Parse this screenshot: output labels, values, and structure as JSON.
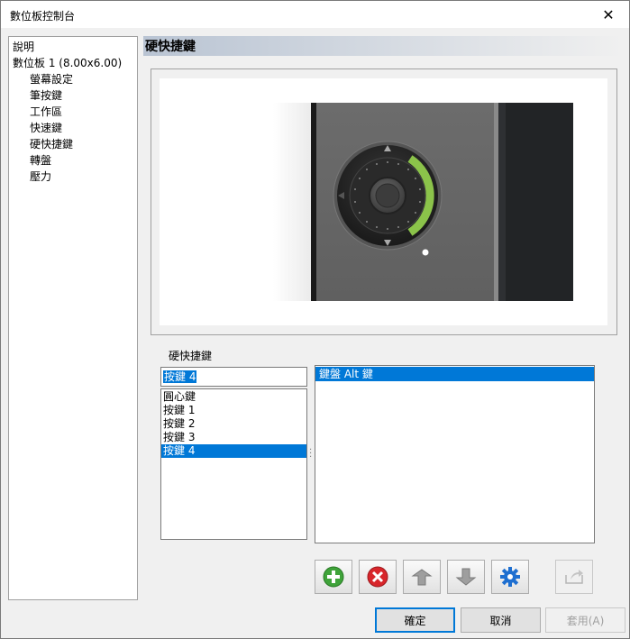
{
  "window": {
    "title": "數位板控制台",
    "close_glyph": "✕"
  },
  "tree": {
    "items": [
      {
        "label": "說明",
        "level": 0
      },
      {
        "label": "數位板 1 (8.00x6.00)",
        "level": 0
      },
      {
        "label": "螢幕設定",
        "level": 1
      },
      {
        "label": "筆按鍵",
        "level": 1
      },
      {
        "label": "工作區",
        "level": 1
      },
      {
        "label": "快速鍵",
        "level": 1
      },
      {
        "label": "硬快捷鍵",
        "level": 1
      },
      {
        "label": "轉盤",
        "level": 1
      },
      {
        "label": "壓力",
        "level": 1
      }
    ]
  },
  "section": {
    "title": "硬快捷鍵"
  },
  "hotkeys": {
    "label": "硬快捷鍵",
    "current_key": "按鍵 4",
    "keys": [
      "圓心鍵",
      "按鍵 1",
      "按鍵 2",
      "按鍵 3",
      "按鍵 4"
    ],
    "selected_key_index": 4,
    "actions": [
      "鍵盤 Alt 鍵"
    ],
    "selected_action_index": 0
  },
  "toolbar": {
    "add_icon": "plus-circle-green",
    "delete_icon": "x-circle-red",
    "move_up_icon": "arrow-up-gray",
    "move_down_icon": "arrow-down-gray",
    "settings_icon": "gear-blue",
    "import_icon": "import-arrow-gray"
  },
  "buttons": {
    "ok": "確定",
    "cancel": "取消",
    "apply": "套用(A)"
  },
  "colors": {
    "selection": "#0078d7",
    "dial_ring_active": "#8bc34a"
  }
}
